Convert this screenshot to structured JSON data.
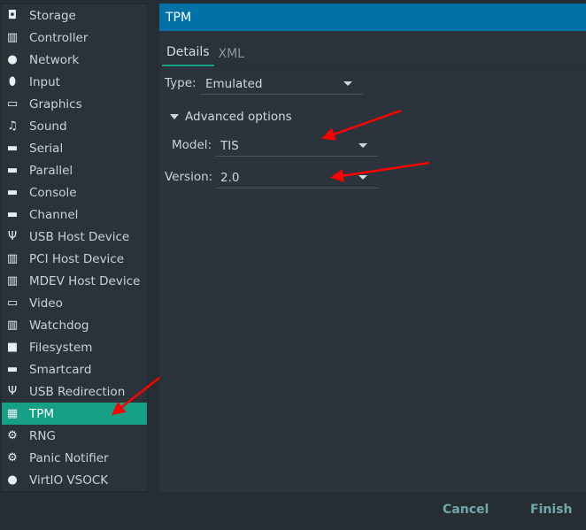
{
  "sidebar": {
    "items": [
      {
        "label": "Storage",
        "icon": "storage-icon",
        "glyph": "◘"
      },
      {
        "label": "Controller",
        "icon": "controller-icon",
        "glyph": "▥"
      },
      {
        "label": "Network",
        "icon": "network-icon",
        "glyph": "●"
      },
      {
        "label": "Input",
        "icon": "mouse-icon",
        "glyph": "⬮"
      },
      {
        "label": "Graphics",
        "icon": "monitor-icon",
        "glyph": "▭"
      },
      {
        "label": "Sound",
        "icon": "sound-icon",
        "glyph": "♫"
      },
      {
        "label": "Serial",
        "icon": "serial-port-icon",
        "glyph": "▬"
      },
      {
        "label": "Parallel",
        "icon": "parallel-port-icon",
        "glyph": "▬"
      },
      {
        "label": "Console",
        "icon": "console-port-icon",
        "glyph": "▬"
      },
      {
        "label": "Channel",
        "icon": "channel-port-icon",
        "glyph": "▬"
      },
      {
        "label": "USB Host Device",
        "icon": "usb-icon",
        "glyph": "Ψ"
      },
      {
        "label": "PCI Host Device",
        "icon": "pci-card-icon",
        "glyph": "▥"
      },
      {
        "label": "MDEV Host Device",
        "icon": "pci-card-icon",
        "glyph": "▥"
      },
      {
        "label": "Video",
        "icon": "monitor-icon",
        "glyph": "▭"
      },
      {
        "label": "Watchdog",
        "icon": "pci-card-icon",
        "glyph": "▥"
      },
      {
        "label": "Filesystem",
        "icon": "folder-icon",
        "glyph": "■"
      },
      {
        "label": "Smartcard",
        "icon": "smartcard-icon",
        "glyph": "▬"
      },
      {
        "label": "USB Redirection",
        "icon": "usb-icon",
        "glyph": "Ψ"
      },
      {
        "label": "TPM",
        "icon": "chip-icon",
        "glyph": "▦"
      },
      {
        "label": "RNG",
        "icon": "gears-icon",
        "glyph": "⚙"
      },
      {
        "label": "Panic Notifier",
        "icon": "gears-icon",
        "glyph": "⚙"
      },
      {
        "label": "VirtIO VSOCK",
        "icon": "network-icon",
        "glyph": "●"
      }
    ],
    "selected": "TPM"
  },
  "panel": {
    "title": "TPM",
    "tabs": [
      {
        "label": "Details"
      },
      {
        "label": "XML"
      }
    ],
    "type": {
      "label": "Type:",
      "value": "Emulated"
    },
    "advanced": {
      "label": "Advanced options"
    },
    "model": {
      "label": "Model:",
      "value": "TIS"
    },
    "version": {
      "label": "Version:",
      "value": "2.0"
    }
  },
  "footer": {
    "cancel": "Cancel",
    "finish": "Finish"
  },
  "colors": {
    "selection": "#16a085",
    "header": "#0172a8",
    "annotation_arrows": "#ff0000"
  }
}
